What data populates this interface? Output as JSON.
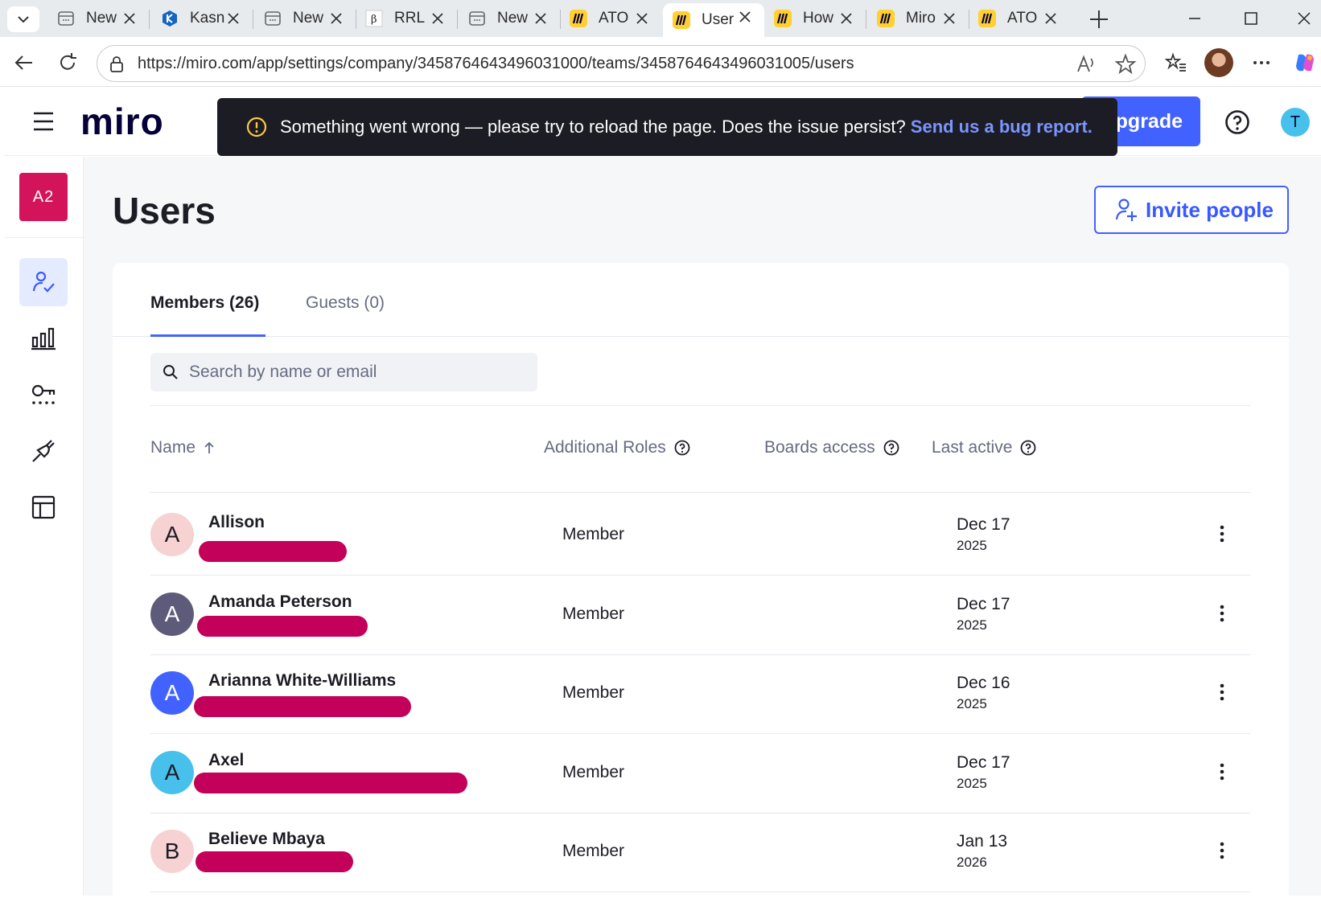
{
  "browser": {
    "tabs": [
      {
        "label": "New",
        "icon": "page-icon"
      },
      {
        "label": "Kasn",
        "icon": "kasm-icon"
      },
      {
        "label": "New",
        "icon": "page-icon"
      },
      {
        "label": "RRL",
        "icon": "rrl-icon"
      },
      {
        "label": "New",
        "icon": "page-icon"
      },
      {
        "label": "ATO",
        "icon": "miro-icon"
      },
      {
        "label": "User",
        "icon": "miro-icon"
      },
      {
        "label": "How",
        "icon": "miro-icon"
      },
      {
        "label": "Miro",
        "icon": "miro-icon"
      },
      {
        "label": "ATO",
        "icon": "miro-icon"
      }
    ],
    "url": "https://miro.com/app/settings/company/3458764643496031000/teams/3458764643496031005/users"
  },
  "app": {
    "logo": "miro",
    "upgrade_label": "Upgrade",
    "user_initial": "T",
    "org_badge": "A2"
  },
  "toast": {
    "message": "Something went wrong — please try to reload the page. Does the issue persist?",
    "link": "Send us a bug report."
  },
  "page": {
    "title": "Users",
    "invite_label": "Invite people",
    "tabs": [
      {
        "label": "Members (26)",
        "active": true
      },
      {
        "label": "Guests (0)",
        "active": false
      }
    ],
    "search_placeholder": "Search by name or email",
    "columns": {
      "name": "Name",
      "roles": "Additional Roles",
      "boards": "Boards access",
      "last_active": "Last active"
    }
  },
  "members": [
    {
      "initial": "A",
      "name": "Allison",
      "role": "Member",
      "date": "Dec 17",
      "year": "2025",
      "avatar_bg": "#f6d2d2",
      "avatar_fg": "#1c1c24"
    },
    {
      "initial": "A",
      "name": "Amanda Peterson",
      "role": "Member",
      "date": "Dec 17",
      "year": "2025",
      "avatar_bg": "#5e5a7a",
      "avatar_fg": "#ffffff"
    },
    {
      "initial": "A",
      "name": "Arianna White-Williams",
      "role": "Member",
      "date": "Dec 16",
      "year": "2025",
      "avatar_bg": "#4262ff",
      "avatar_fg": "#ffffff"
    },
    {
      "initial": "A",
      "name": "Axel",
      "role": "Member",
      "date": "Dec 17",
      "year": "2025",
      "avatar_bg": "#47c1ec",
      "avatar_fg": "#1c1c24"
    },
    {
      "initial": "B",
      "name": "Believe Mbaya",
      "role": "Member",
      "date": "Jan 13",
      "year": "2026",
      "avatar_bg": "#f6d2d2",
      "avatar_fg": "#1c1c24"
    }
  ],
  "colors": {
    "accent": "#4262ff",
    "redaction": "#c3005a",
    "org_badge": "#d4145a"
  }
}
